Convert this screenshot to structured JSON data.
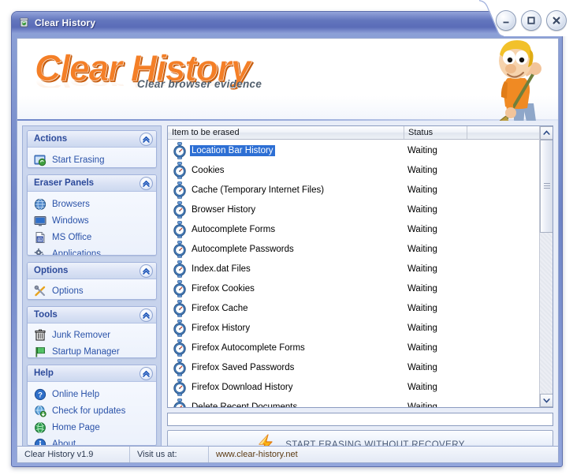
{
  "window": {
    "title": "Clear History",
    "icon": "trash-bin-icon",
    "controls": {
      "minimize": "minimize-button",
      "maximize": "maximize-button",
      "close": "close-button"
    }
  },
  "banner": {
    "logo_text": "Clear History",
    "tagline": "Clear browser evidence",
    "logo_color": "#f47f27",
    "mascot": "cartoon-man-with-broom"
  },
  "sidebar": {
    "panels": [
      {
        "title": "Actions",
        "collapse_icon": "chevron-double-up-icon",
        "items": [
          {
            "label": "Start Erasing",
            "icon": "start-erasing-icon"
          }
        ]
      },
      {
        "title": "Eraser Panels",
        "collapse_icon": "chevron-double-up-icon",
        "items": [
          {
            "label": "Browsers",
            "icon": "globe-icon"
          },
          {
            "label": "Windows",
            "icon": "monitor-icon"
          },
          {
            "label": "MS Office",
            "icon": "word-document-icon"
          },
          {
            "label": "Applications",
            "icon": "gears-icon"
          }
        ]
      },
      {
        "title": "Options",
        "collapse_icon": "chevron-double-up-icon",
        "items": [
          {
            "label": "Options",
            "icon": "tools-cross-icon"
          }
        ]
      },
      {
        "title": "Tools",
        "collapse_icon": "chevron-double-up-icon",
        "items": [
          {
            "label": "Junk Remover",
            "icon": "trash-can-icon"
          },
          {
            "label": "Startup Manager",
            "icon": "flag-icon"
          }
        ]
      },
      {
        "title": "Help",
        "collapse_icon": "chevron-double-up-icon",
        "items": [
          {
            "label": "Online Help",
            "icon": "question-mark-icon"
          },
          {
            "label": "Check for updates",
            "icon": "globe-refresh-icon"
          },
          {
            "label": "Home Page",
            "icon": "green-globe-icon"
          },
          {
            "label": "About",
            "icon": "info-icon"
          }
        ]
      }
    ]
  },
  "list": {
    "columns": [
      "Item to be erased",
      "Status",
      ""
    ],
    "rows": [
      {
        "item": "Location Bar History",
        "status": "Waiting",
        "selected": true
      },
      {
        "item": "Cookies",
        "status": "Waiting",
        "selected": false
      },
      {
        "item": "Cache (Temporary Internet Files)",
        "status": "Waiting",
        "selected": false
      },
      {
        "item": "Browser History",
        "status": "Waiting",
        "selected": false
      },
      {
        "item": "Autocomplete Forms",
        "status": "Waiting",
        "selected": false
      },
      {
        "item": "Autocomplete Passwords",
        "status": "Waiting",
        "selected": false
      },
      {
        "item": "Index.dat Files",
        "status": "Waiting",
        "selected": false
      },
      {
        "item": "Firefox Cookies",
        "status": "Waiting",
        "selected": false
      },
      {
        "item": "Firefox Cache",
        "status": "Waiting",
        "selected": false
      },
      {
        "item": "Firefox History",
        "status": "Waiting",
        "selected": false
      },
      {
        "item": "Firefox Autocomplete Forms",
        "status": "Waiting",
        "selected": false
      },
      {
        "item": "Firefox Saved Passwords",
        "status": "Waiting",
        "selected": false
      },
      {
        "item": "Firefox Download History",
        "status": "Waiting",
        "selected": false
      },
      {
        "item": "Delete Recent Documents",
        "status": "Waiting",
        "selected": false
      }
    ],
    "row_icon": "stopwatch-icon",
    "selection_color": "#2d6fd4"
  },
  "action_button": {
    "label": "START ERASING WITHOUT RECOVERY",
    "icon": "lightning-bolt-icon"
  },
  "progress": {
    "value": 0
  },
  "statusbar": {
    "version": "Clear History v1.9",
    "visit_label": "Visit us at:",
    "url": "www.clear-history.net"
  }
}
